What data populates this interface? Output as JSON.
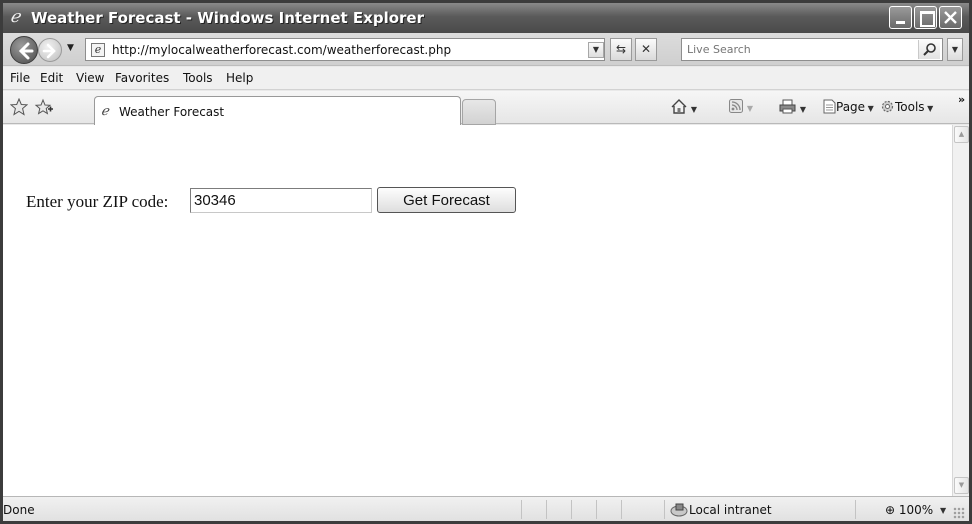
{
  "window": {
    "title": "Weather Forecast - Windows Internet Explorer"
  },
  "address_bar": {
    "url": "http://mylocalweatherforecast.com/weatherforecast.php",
    "search_placeholder": "Live Search"
  },
  "menu": {
    "items": [
      "File",
      "Edit",
      "View",
      "Favorites",
      "Tools",
      "Help"
    ]
  },
  "tabs": {
    "active_label": "Weather Forecast"
  },
  "command_bar": {
    "page_label": "Page",
    "tools_label": "Tools"
  },
  "form": {
    "zip_label": "Enter your ZIP code:",
    "zip_value": "30346",
    "button_label": "Get Forecast"
  },
  "status_bar": {
    "status": "Done",
    "zone": "Local intranet",
    "zoom": "100%"
  },
  "icons": [
    "ie-icon",
    "back-icon",
    "forward-icon",
    "page-icon",
    "refresh-icon",
    "stop-icon",
    "search-icon",
    "favorites-star-icon",
    "add-favorites-icon",
    "home-icon",
    "feeds-icon",
    "print-icon",
    "page-menu-icon",
    "tools-gear-icon",
    "zone-icon",
    "zoom-icon"
  ]
}
